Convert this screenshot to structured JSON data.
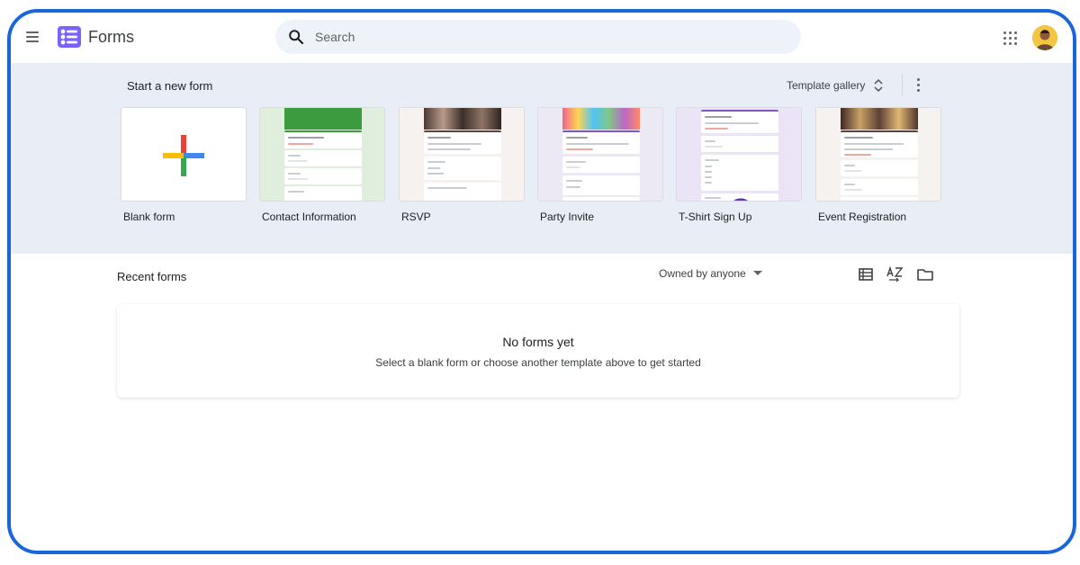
{
  "app": {
    "title": "Forms"
  },
  "search": {
    "placeholder": "Search"
  },
  "templates_section": {
    "title": "Start a new form",
    "gallery_label": "Template gallery",
    "templates": [
      {
        "label": "Blank form"
      },
      {
        "label": "Contact Information"
      },
      {
        "label": "RSVP"
      },
      {
        "label": "Party Invite"
      },
      {
        "label": "T-Shirt Sign Up"
      },
      {
        "label": "Event Registration"
      }
    ]
  },
  "recent": {
    "title": "Recent forms",
    "owner_filter": "Owned by anyone",
    "empty_title": "No forms yet",
    "empty_subtitle": "Select a blank form or choose another template above to get started"
  },
  "icons": {
    "menu": "menu-icon",
    "logo": "forms-logo-icon",
    "search": "search-icon",
    "apps": "apps-grid-icon",
    "sort": "sort-icon",
    "more": "more-vert-icon",
    "list_view": "list-view-icon",
    "sort_az": "sort-az-icon",
    "folder": "folder-icon"
  },
  "colors": {
    "accent": "#1a66d9",
    "forms_purple": "#7b61ff",
    "band": "#e9eef6",
    "google_blue": "#4285f4",
    "google_red": "#ea4335",
    "google_yellow": "#fbbc04",
    "google_green": "#34a853"
  }
}
